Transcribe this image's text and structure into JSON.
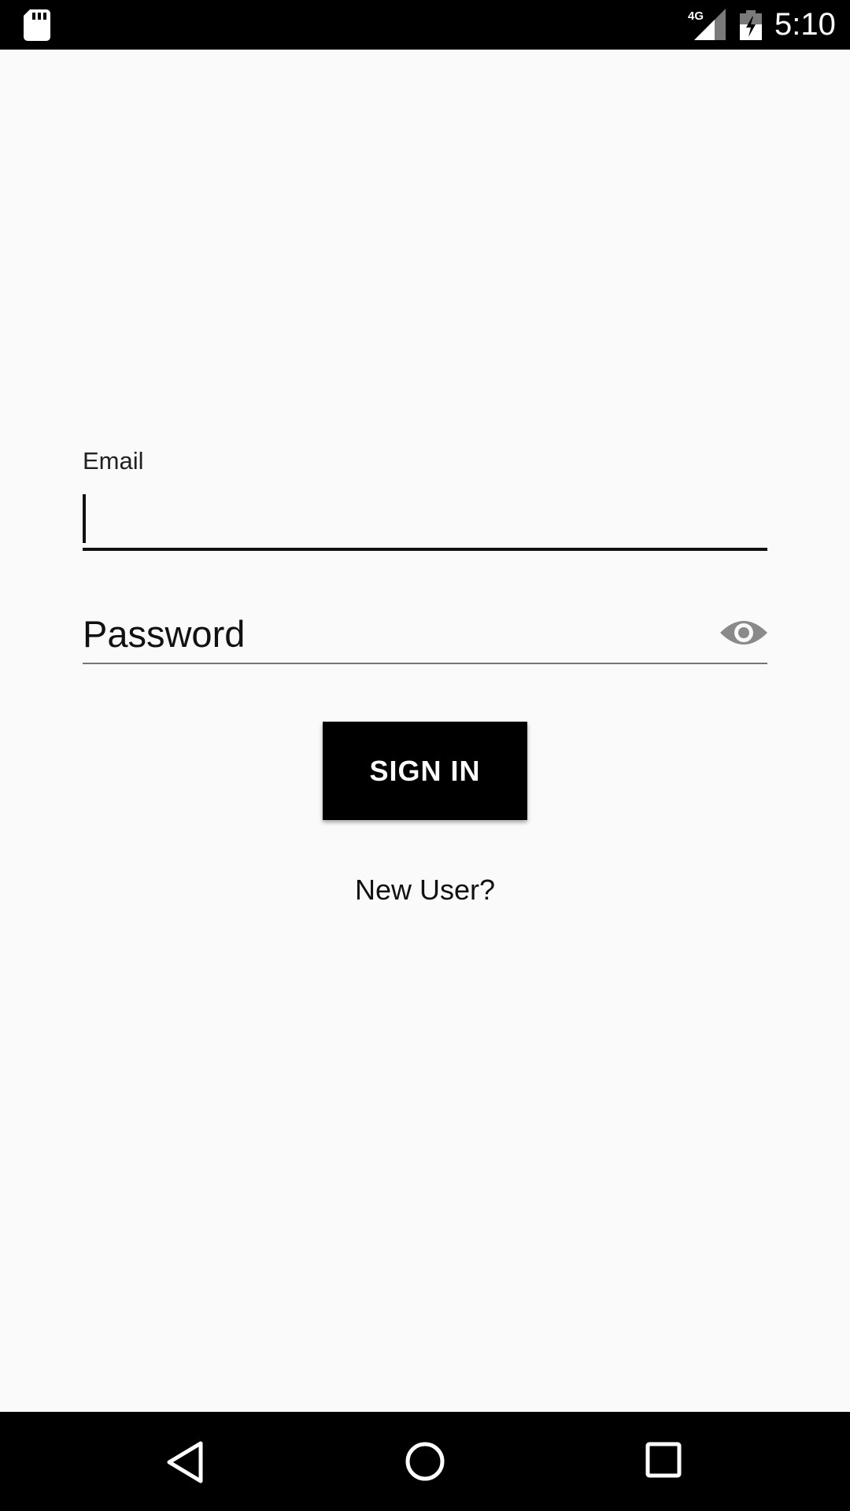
{
  "status_bar": {
    "time": "5:10",
    "network_label": "4G",
    "icons": [
      "sd-card-icon",
      "cellular-signal-icon",
      "battery-charging-icon"
    ]
  },
  "login": {
    "email_label": "Email",
    "email_value": "",
    "password_placeholder": "Password",
    "password_value": "",
    "sign_in_label": "SIGN IN",
    "new_user_label": "New User?"
  },
  "nav_bar": {
    "icons": [
      "back-icon",
      "home-icon",
      "recents-icon"
    ]
  },
  "colors": {
    "background": "#fafafa",
    "button_bg": "#000000",
    "button_text": "#ffffff",
    "text": "#111111",
    "underline_focused": "#111111",
    "underline_idle": "#757575",
    "eye_icon": "#8a8a8a"
  }
}
